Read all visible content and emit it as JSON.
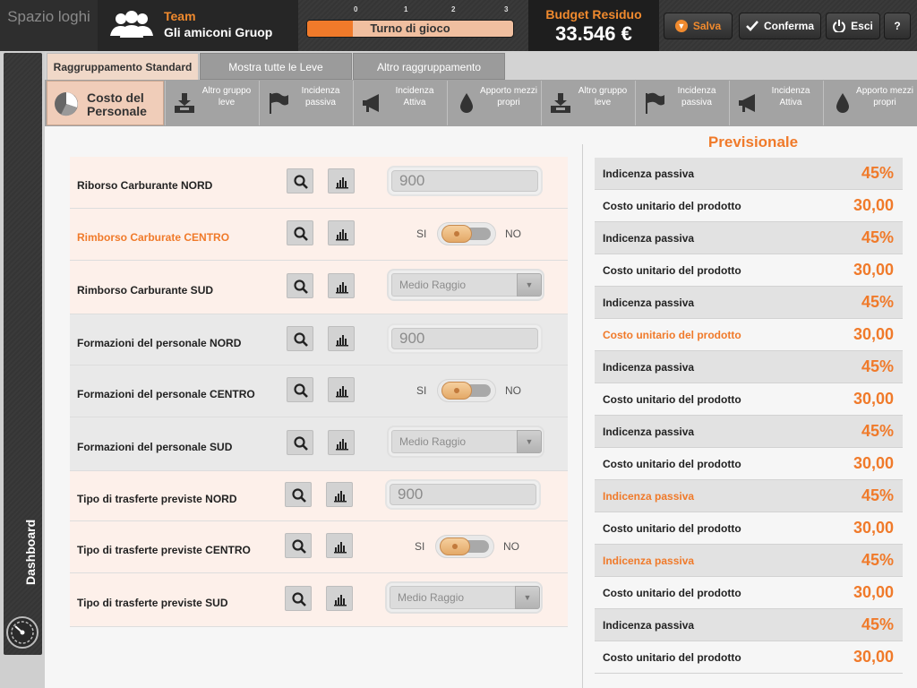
{
  "app": {
    "logo": "Spazio loghi"
  },
  "team": {
    "label": "Team",
    "name": "Gli amiconi Gruop"
  },
  "turn": {
    "label": "Turno di gioco",
    "ticks": [
      "0",
      "1",
      "2",
      "3"
    ],
    "progress_fraction": 0.22
  },
  "budget": {
    "label": "Budget Residuo",
    "value": "33.546 €"
  },
  "toolbar": {
    "save": "Salva",
    "confirm": "Conferma",
    "exit": "Esci",
    "help": "?"
  },
  "sidebar": {
    "dashboard": "Dashboard"
  },
  "tabs": [
    {
      "label": "Raggruppamento  Standard",
      "active": true
    },
    {
      "label": "Mostra tutte le Leve",
      "active": false
    },
    {
      "label": "Altro raggruppamento",
      "active": false
    }
  ],
  "levers": {
    "main": "Costo del Personale",
    "items": [
      {
        "label": "Altro gruppo leve",
        "icon": "inbox-icon"
      },
      {
        "label": "Incidenza passiva",
        "icon": "flag-icon"
      },
      {
        "label": "Incidenza Attiva",
        "icon": "megaphone-icon"
      },
      {
        "label": "Apporto mezzi propri",
        "icon": "drop-icon"
      },
      {
        "label": "Altro gruppo leve",
        "icon": "inbox-icon"
      },
      {
        "label": "Incidenza passiva",
        "icon": "flag-icon"
      },
      {
        "label": "Incidenza Attiva",
        "icon": "megaphone-icon"
      },
      {
        "label": "Apporto mezzi propri",
        "icon": "drop-icon"
      }
    ]
  },
  "form": {
    "toggle_yes": "SI",
    "toggle_no": "NO",
    "rows": [
      {
        "label": "Riborso Carburante NORD",
        "control": "number",
        "value": "900",
        "highlight": false
      },
      {
        "label": "Rimborso Carburate CENTRO",
        "control": "toggle",
        "value": "SI",
        "highlight": true
      },
      {
        "label": "Rimborso Carburante SUD",
        "control": "select",
        "value": "Medio Raggio",
        "highlight": false
      },
      {
        "label": "Formazioni del personale NORD",
        "control": "number",
        "value": "900",
        "highlight": false
      },
      {
        "label": "Formazioni del personale CENTRO",
        "control": "toggle",
        "value": "SI",
        "highlight": false
      },
      {
        "label": "Formazioni del personale SUD",
        "control": "select",
        "value": "Medio Raggio",
        "highlight": false
      },
      {
        "label": "Tipo di trasferte previste NORD",
        "control": "number",
        "value": "900",
        "highlight": false
      },
      {
        "label": "Tipo di trasferte previste CENTRO",
        "control": "toggle",
        "value": "SI",
        "highlight": false
      },
      {
        "label": "Tipo di trasferte previste SUD",
        "control": "select",
        "value": "Medio Raggio",
        "highlight": false
      }
    ]
  },
  "previsionale": {
    "title": "Previsionale",
    "rows": [
      {
        "label": "Indicenza passiva",
        "value": "45%",
        "highlight": false
      },
      {
        "label": "Costo unitario del prodotto",
        "value": "30,00",
        "highlight": false
      },
      {
        "label": "Indicenza passiva",
        "value": "45%",
        "highlight": false
      },
      {
        "label": "Costo unitario del prodotto",
        "value": "30,00",
        "highlight": false
      },
      {
        "label": "Indicenza passiva",
        "value": "45%",
        "highlight": false
      },
      {
        "label": "Costo unitario del prodotto",
        "value": "30,00",
        "highlight": true
      },
      {
        "label": "Indicenza passiva",
        "value": "45%",
        "highlight": false
      },
      {
        "label": "Costo unitario del prodotto",
        "value": "30,00",
        "highlight": false
      },
      {
        "label": "Indicenza passiva",
        "value": "45%",
        "highlight": false
      },
      {
        "label": "Costo unitario del prodotto",
        "value": "30,00",
        "highlight": false
      },
      {
        "label": "Indicenza passiva",
        "value": "45%",
        "highlight": true
      },
      {
        "label": "Costo unitario del prodotto",
        "value": "30,00",
        "highlight": false
      },
      {
        "label": "Indicenza passiva",
        "value": "45%",
        "highlight": true
      },
      {
        "label": "Costo unitario del prodotto",
        "value": "30,00",
        "highlight": false
      },
      {
        "label": "Indicenza passiva",
        "value": "45%",
        "highlight": false
      },
      {
        "label": "Costo unitario del prodotto",
        "value": "30,00",
        "highlight": false
      }
    ]
  },
  "colors": {
    "accent": "#f07a2a",
    "dark": "#262626",
    "panel": "#f6f6f6"
  }
}
